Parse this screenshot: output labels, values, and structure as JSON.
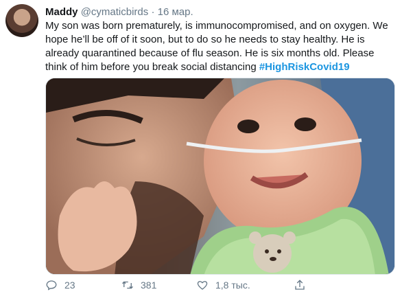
{
  "tweet": {
    "author_name": "Maddy",
    "author_handle": "@cymaticbirds",
    "separator": "·",
    "date": "16 мар.",
    "text_main": "My son was born prematurely, is immunocompromised, and on oxygen. We hope he’ll be off of it soon, but to do so he needs to stay healthy. He is already quarantined because of flu season. He is six months old. Please think of him before you break social distancing ",
    "hashtag": "#HighRiskCovid19"
  },
  "actions": {
    "reply_count": "23",
    "retweet_count": "381",
    "like_count": "1,8 тыс."
  },
  "colors": {
    "text": "#14171a",
    "secondary": "#657786",
    "link": "#1b95e0"
  },
  "icons": [
    "reply-icon",
    "retweet-icon",
    "like-icon",
    "share-icon"
  ]
}
